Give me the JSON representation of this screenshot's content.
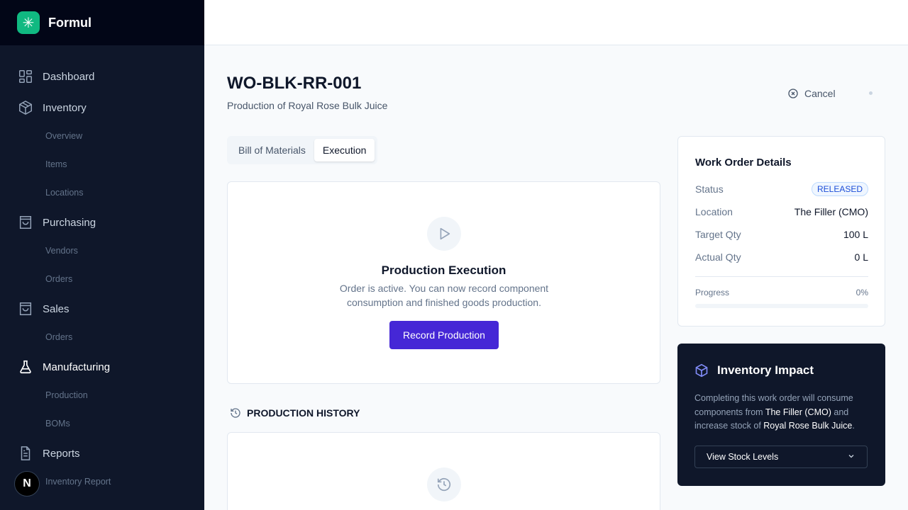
{
  "brand": {
    "name": "Formul"
  },
  "sidebar": {
    "items": [
      {
        "label": "Dashboard",
        "icon": "dashboard-icon"
      },
      {
        "label": "Inventory",
        "icon": "box-icon",
        "children": [
          "Overview",
          "Items",
          "Locations"
        ]
      },
      {
        "label": "Purchasing",
        "icon": "bag-icon",
        "children": [
          "Vendors",
          "Orders"
        ]
      },
      {
        "label": "Sales",
        "icon": "bag-icon",
        "children": [
          "Orders"
        ]
      },
      {
        "label": "Manufacturing",
        "icon": "flask-icon",
        "children": [
          "Production",
          "BOMs"
        ],
        "active": true
      },
      {
        "label": "Reports",
        "icon": "document-icon",
        "children": [
          "Inventory Report"
        ]
      }
    ],
    "avatar_letter": "N"
  },
  "header": {
    "title": "WO-BLK-RR-001",
    "subtitle": "Production of Royal Rose Bulk Juice",
    "cancel_label": "Cancel"
  },
  "tabs": [
    {
      "label": "Bill of Materials",
      "active": false
    },
    {
      "label": "Execution",
      "active": true
    }
  ],
  "execution": {
    "title": "Production Execution",
    "description": "Order is active. You can now record component consumption and finished goods production.",
    "button_label": "Record Production"
  },
  "history": {
    "title": "PRODUCTION HISTORY"
  },
  "details": {
    "title": "Work Order Details",
    "rows": [
      {
        "label": "Status",
        "value": "RELEASED"
      },
      {
        "label": "Location",
        "value": "The Filler (CMO)"
      },
      {
        "label": "Target Qty",
        "value": "100 L"
      },
      {
        "label": "Actual Qty",
        "value": "0 L"
      }
    ],
    "progress_label": "Progress",
    "progress_text": "0%",
    "progress_value": 0
  },
  "impact": {
    "title": "Inventory Impact",
    "text_1": "Completing this work order will consume components from ",
    "location": "The Filler (CMO)",
    "text_2": " and increase stock of ",
    "product": "Royal Rose Bulk Juice",
    "text_3": ".",
    "select_label": "View Stock Levels"
  },
  "colors": {
    "accent": "#4527d6",
    "brand": "#10b981",
    "sidebar_bg": "#0f172a"
  }
}
